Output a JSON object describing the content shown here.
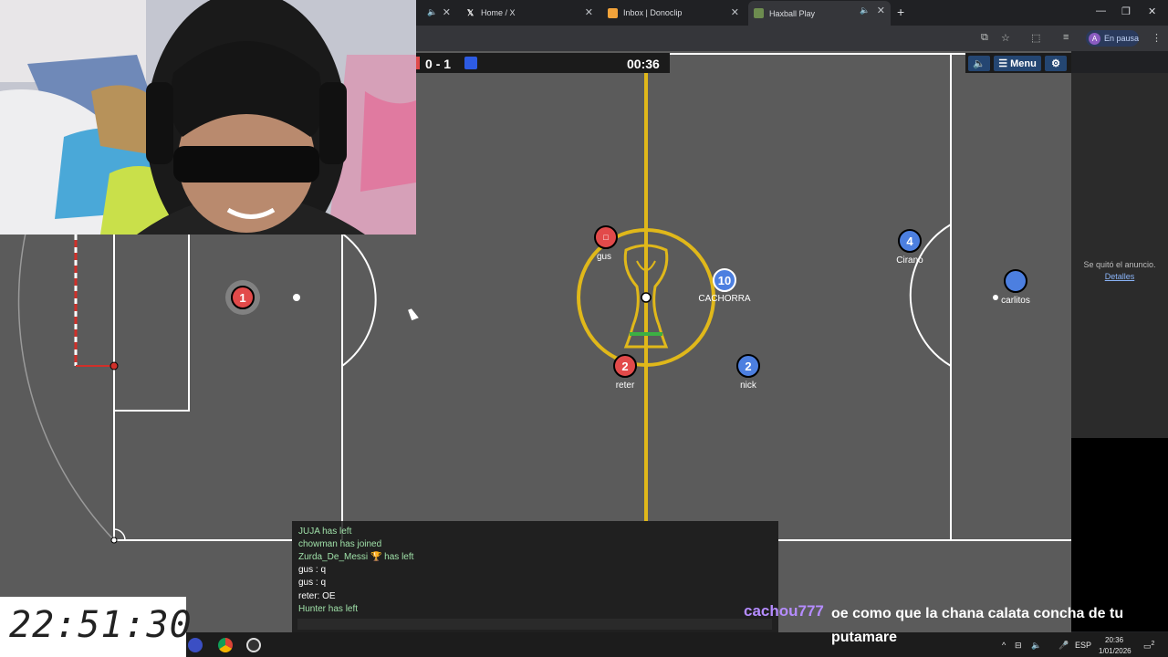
{
  "browser": {
    "tabs": [
      {
        "label": "",
        "icon": "speaker-icon"
      },
      {
        "label": "Home / X",
        "icon": "x-logo-icon"
      },
      {
        "label": "Inbox | Donoclip",
        "icon": "donoclip-icon"
      },
      {
        "label": "Haxball Play",
        "icon": "haxball-icon"
      }
    ],
    "profile_initial": "A",
    "pause_label": "En pausa"
  },
  "game": {
    "score_red": "0",
    "score_sep": "-",
    "score_blue": "1",
    "timer": "00:36",
    "menu_label": "Menu",
    "colors": {
      "red_team": "#e24a4a",
      "blue_team": "#4c7fe0",
      "field": "#5b5b5b",
      "center_line": "#e0b81a"
    },
    "players": [
      {
        "number": "1",
        "name": "",
        "team": "red"
      },
      {
        "number": "",
        "name": "gus",
        "team": "red"
      },
      {
        "number": "2",
        "name": "reter",
        "team": "red"
      },
      {
        "number": "10",
        "name": "CACHORRA",
        "team": "blue"
      },
      {
        "number": "2",
        "name": "nick",
        "team": "blue"
      },
      {
        "number": "4",
        "name": "Cirano",
        "team": "blue"
      },
      {
        "number": "",
        "name": "carlitos",
        "team": "blue"
      }
    ]
  },
  "ad": {
    "removed_text": "Se quitó el anuncio.",
    "details_link": "Detalles"
  },
  "chat": {
    "lines": [
      {
        "text": "JUJA has left",
        "kind": "system"
      },
      {
        "text": "chowman has joined",
        "kind": "system"
      },
      {
        "text": "Zurda_De_Messi",
        "suffix": "has left",
        "kind": "system"
      },
      {
        "text": "gus : q",
        "kind": "msg"
      },
      {
        "text": "gus : q",
        "kind": "msg"
      },
      {
        "text": "reter: OE",
        "kind": "msg"
      },
      {
        "text": "Hunter has left",
        "kind": "system"
      }
    ]
  },
  "overlay": {
    "clock": "22:51:30",
    "stream_user": "cachou777",
    "stream_message": "oe como que la chana calata concha de tu putamare"
  },
  "taskbar": {
    "lang": "ESP",
    "time": "20:36",
    "date": "1/01/2026",
    "notifications": "2"
  }
}
